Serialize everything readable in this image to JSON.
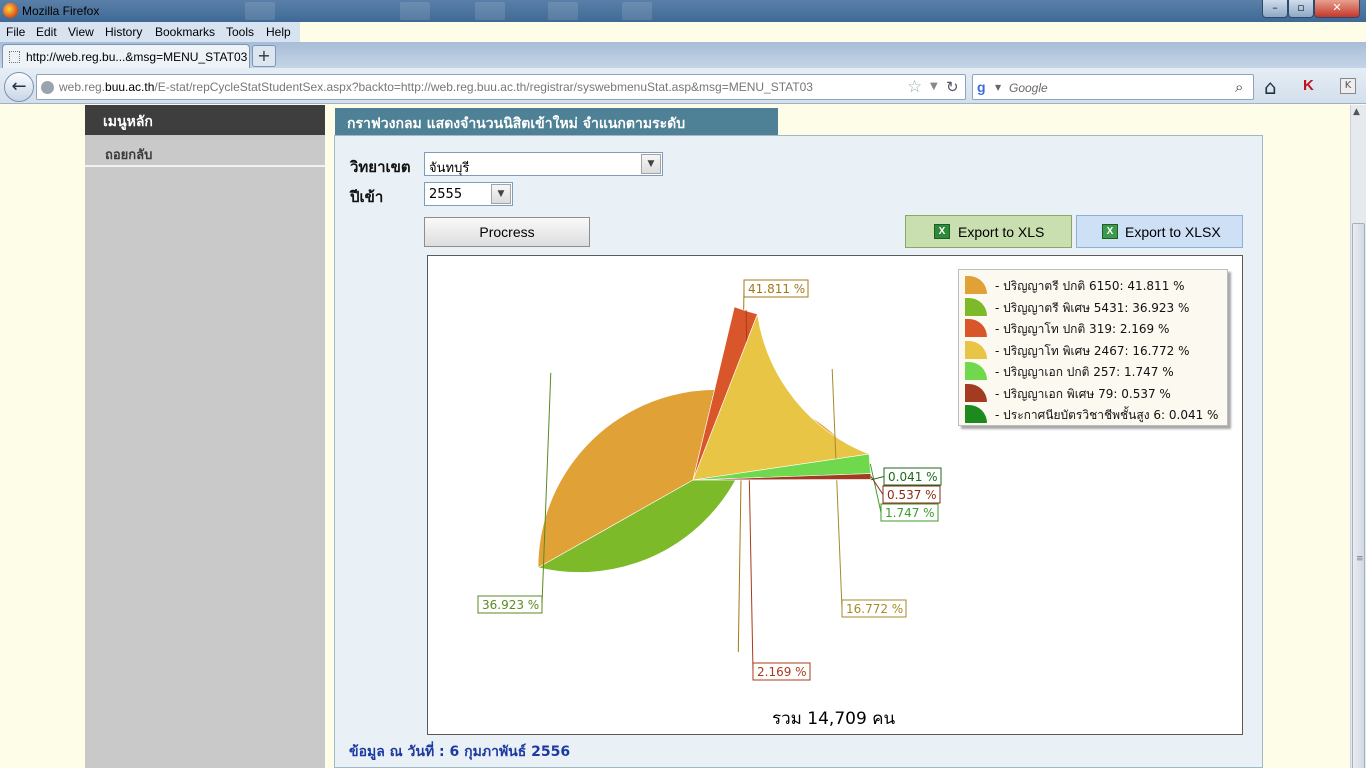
{
  "browser": {
    "window_title": "Mozilla Firefox",
    "menu": [
      "File",
      "Edit",
      "View",
      "History",
      "Bookmarks",
      "Tools",
      "Help"
    ],
    "tab_title": "http://web.reg.bu...&msg=MENU_STAT03",
    "new_tab": "+",
    "url_prefix": "web.reg.",
    "url_domain": "buu.ac.th",
    "url_rest": "/E-stat/repCycleStatStudentSex.aspx?backto=http://web.reg.buu.ac.th/registrar/syswebmenuStat.asp&msg=MENU_STAT03",
    "search_placeholder": "Google"
  },
  "sidebar": {
    "header": "เมนูหลัก",
    "items": [
      {
        "label": "ถอยกลับ"
      }
    ]
  },
  "panel": {
    "title": "กราฟวงกลม แสดงจำนวนนิสิตเข้าใหม่ จำแนกตามระดับ",
    "campus_label": "วิทยาเขต",
    "campus_value": "จันทบุรี",
    "year_label": "ปีเข้า",
    "year_value": "2555",
    "process_label": "Procress",
    "export_xls_label": "Export to XLS",
    "export_xlsx_label": "Export to XLSX",
    "total_text": "รวม 14,709 คน",
    "date_text": "ข้อมูล ณ วันที่ : 6 กุมภาพันธ์ 2556"
  },
  "chart_data": {
    "type": "pie",
    "total": 14709,
    "slices": [
      {
        "name": "ปริญญาตรี ปกติ",
        "value": 6150,
        "percent": 41.811,
        "legend": "- ปริญญาตรี ปกติ 6150: 41.811 %",
        "label": "41.811 %",
        "color": "#e0a236",
        "label_color": "#a07a18"
      },
      {
        "name": "ปริญญาตรี พิเศษ",
        "value": 5431,
        "percent": 36.923,
        "legend": "- ปริญญาตรี พิเศษ 5431: 36.923 %",
        "label": "36.923 %",
        "color": "#7cba2a",
        "label_color": "#5a8a20"
      },
      {
        "name": "ปริญญาโท ปกติ",
        "value": 319,
        "percent": 2.169,
        "legend": "- ปริญญาโท ปกติ 319: 2.169 %",
        "label": "2.169 %",
        "color": "#d9562a",
        "label_color": "#a83b1a"
      },
      {
        "name": "ปริญญาโท พิเศษ",
        "value": 2467,
        "percent": 16.772,
        "legend": "- ปริญญาโท พิเศษ 2467: 16.772 %",
        "label": "16.772 %",
        "color": "#e9c545",
        "label_color": "#a68a2a"
      },
      {
        "name": "ปริญญาเอก ปกติ",
        "value": 257,
        "percent": 1.747,
        "legend": "- ปริญญาเอก ปกติ 257: 1.747 %",
        "label": "1.747 %",
        "color": "#6fd84c",
        "label_color": "#3f9a2a"
      },
      {
        "name": "ปริญญาเอก พิเศษ",
        "value": 79,
        "percent": 0.537,
        "legend": "- ปริญญาเอก พิเศษ 79: 0.537 %",
        "label": "0.537 %",
        "color": "#a23b22",
        "label_color": "#8a2a18"
      },
      {
        "name": "ประกาศนียบัตรวิชาชีพชั้นสูง",
        "value": 6,
        "percent": 0.041,
        "legend": "- ประกาศนียบัตรวิชาชีพชั้นสูง 6: 0.041 %",
        "label": "0.041 %",
        "color": "#1d8a1d",
        "label_color": "#1d6a1d"
      }
    ],
    "legend_position": "top-right"
  }
}
